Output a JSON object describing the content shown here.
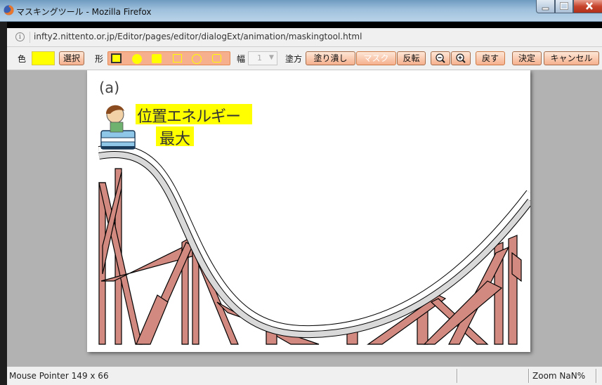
{
  "window": {
    "title": "マスキングツール - Mozilla Firefox"
  },
  "address": {
    "url": "infty2.nittento.or.jp/Editor/pages/editor/dialogExt/animation/maskingtool.html"
  },
  "toolbar": {
    "color_label": "色",
    "color_value": "#ffff00",
    "select_button": "選択",
    "shape_label": "形",
    "shapes": [
      "filled-square",
      "filled-circle",
      "filled-rounded-square",
      "outline-square",
      "outline-circle",
      "outline-rounded-square"
    ],
    "width_label": "幅",
    "width_value": "1",
    "fill_label": "塗方",
    "fill_button": "塗り潰し",
    "mask_button": "マスク",
    "invert_button": "反転",
    "zoom_out_icon": "zoom-out-icon",
    "zoom_in_icon": "zoom-in-icon",
    "undo_button": "戻す",
    "ok_button": "決定",
    "cancel_button": "キャンセル"
  },
  "canvas": {
    "panel_label": "(a)",
    "highlight_line1": "位置エネルギー",
    "highlight_line2": "最大",
    "highlight_color": "#ffff00",
    "track_color": "#d9d9d9",
    "support_color": "#d28a80"
  },
  "status": {
    "pointer": "Mouse Pointer 149 x 66",
    "zoom": "Zoom NaN%"
  }
}
